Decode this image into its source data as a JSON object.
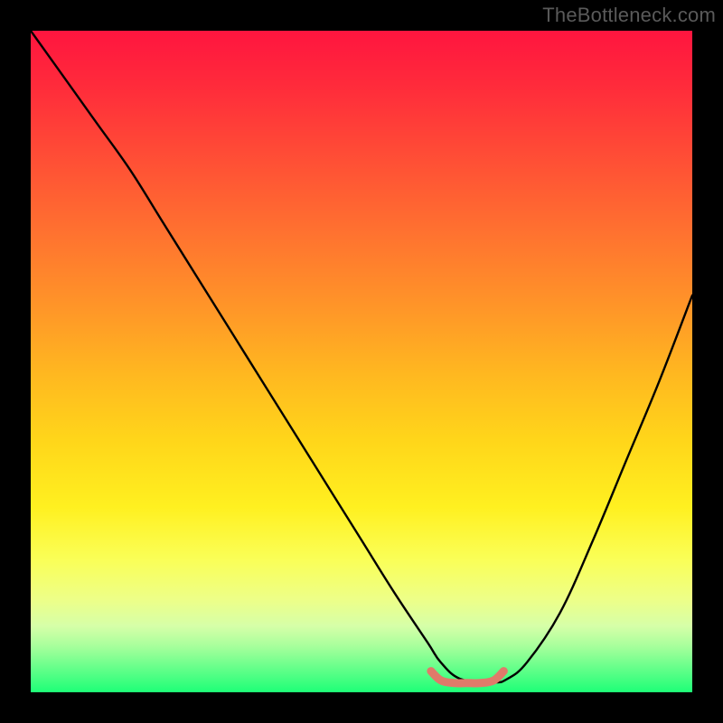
{
  "watermark": "TheBottleneck.com",
  "chart_data": {
    "type": "line",
    "title": "",
    "xlabel": "",
    "ylabel": "",
    "xlim": [
      0,
      100
    ],
    "ylim": [
      0,
      100
    ],
    "background_gradient": {
      "direction": "vertical",
      "stops": [
        {
          "pos": 0,
          "color": "#ff153f"
        },
        {
          "pos": 18,
          "color": "#ff4a36"
        },
        {
          "pos": 42,
          "color": "#ff9628"
        },
        {
          "pos": 62,
          "color": "#ffd61a"
        },
        {
          "pos": 80,
          "color": "#faff58"
        },
        {
          "pos": 93,
          "color": "#a8ff9c"
        },
        {
          "pos": 100,
          "color": "#1eff77"
        }
      ]
    },
    "series": [
      {
        "name": "bottleneck-curve",
        "type": "line",
        "color": "#000000",
        "x": [
          0,
          5,
          10,
          15,
          20,
          25,
          30,
          35,
          40,
          45,
          50,
          55,
          60,
          62,
          65,
          70,
          72,
          75,
          80,
          85,
          90,
          95,
          100
        ],
        "y": [
          100,
          93,
          86,
          79,
          71,
          63,
          55,
          47,
          39,
          31,
          23,
          15,
          7.5,
          4.5,
          2.0,
          1.5,
          2.0,
          4.5,
          12,
          23,
          35,
          47,
          60
        ]
      },
      {
        "name": "optimal-marker",
        "type": "line",
        "color": "#e07a6a",
        "stroke_width": 9,
        "x": [
          60.5,
          62,
          64,
          66,
          68,
          70,
          71.5
        ],
        "y": [
          3.2,
          1.8,
          1.4,
          1.4,
          1.4,
          1.8,
          3.2
        ]
      }
    ]
  }
}
